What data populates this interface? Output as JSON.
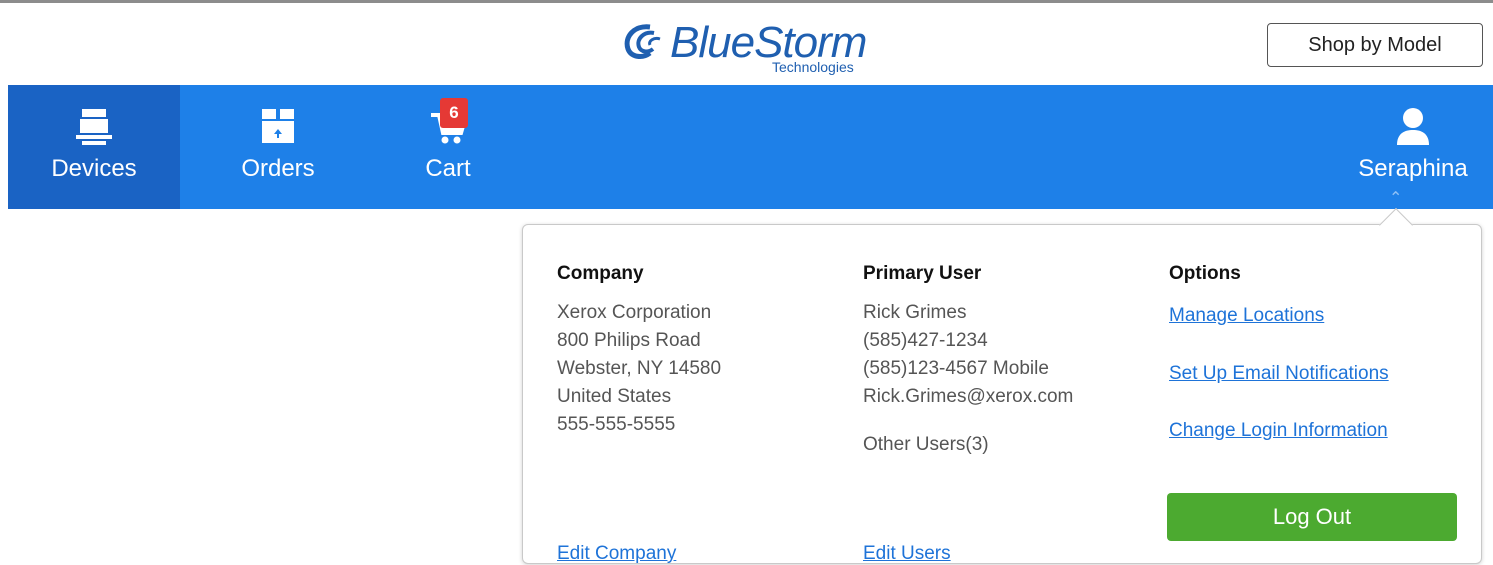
{
  "brand": {
    "name": "BlueStorm",
    "tagline": "Technologies",
    "color": "#1f5fb0"
  },
  "header": {
    "shop_by_model": "Shop by Model"
  },
  "nav": {
    "items": [
      {
        "label": "Devices",
        "icon": "printer-icon",
        "active": true
      },
      {
        "label": "Orders",
        "icon": "box-icon",
        "active": false
      },
      {
        "label": "Cart",
        "icon": "cart-icon",
        "active": false
      }
    ],
    "cart_count": "6",
    "user_name": "Seraphina",
    "bar_color": "#1e80e8",
    "active_color": "#1a63c4"
  },
  "account_panel": {
    "company": {
      "heading": "Company",
      "lines": [
        "Xerox Corporation",
        "800 Philips Road",
        "Webster, NY 14580",
        "United States",
        "555-555-5555"
      ],
      "edit_link": "Edit Company"
    },
    "primary_user": {
      "heading": "Primary User",
      "lines": [
        "Rick Grimes",
        "(585)427-1234",
        "(585)123-4567 Mobile",
        "Rick.Grimes@xerox.com"
      ],
      "other_users": "Other Users(3)",
      "edit_link": "Edit Users"
    },
    "options": {
      "heading": "Options",
      "links": [
        "Manage Locations",
        "Set Up Email Notifications",
        "Change Login Information"
      ],
      "logout": "Log Out",
      "logout_color": "#4caa30"
    }
  }
}
